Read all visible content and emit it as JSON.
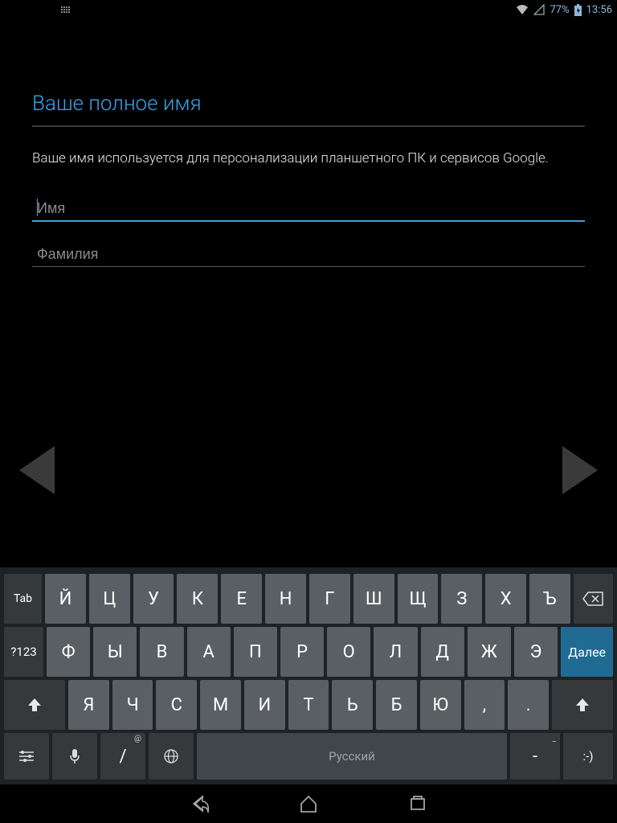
{
  "statusbar": {
    "battery": "77%",
    "time": "13:56"
  },
  "screen": {
    "title": "Ваше полное имя",
    "description": "Ваше имя используется для персонализации планшетного ПК и сервисов Google.",
    "first_name_placeholder": "Имя",
    "last_name_placeholder": "Фамилия"
  },
  "keyboard": {
    "tab": "Tab",
    "row1": [
      "Й",
      "Ц",
      "У",
      "К",
      "Е",
      "Н",
      "Г",
      "Ш",
      "Щ",
      "З",
      "Х",
      "Ъ"
    ],
    "sym": "?123",
    "row2": [
      "Ф",
      "Ы",
      "В",
      "А",
      "П",
      "Р",
      "О",
      "Л",
      "Д",
      "Ж",
      "Э"
    ],
    "next": "Далее",
    "row3": [
      "Я",
      "Ч",
      "С",
      "М",
      "И",
      "Т",
      "Ь",
      "Б",
      "Ю",
      ",",
      "."
    ],
    "slash": "/",
    "slash_sup": "@",
    "space": "Русский",
    "dash": "-",
    "dash_sup": "_",
    "smile": ":-)"
  }
}
